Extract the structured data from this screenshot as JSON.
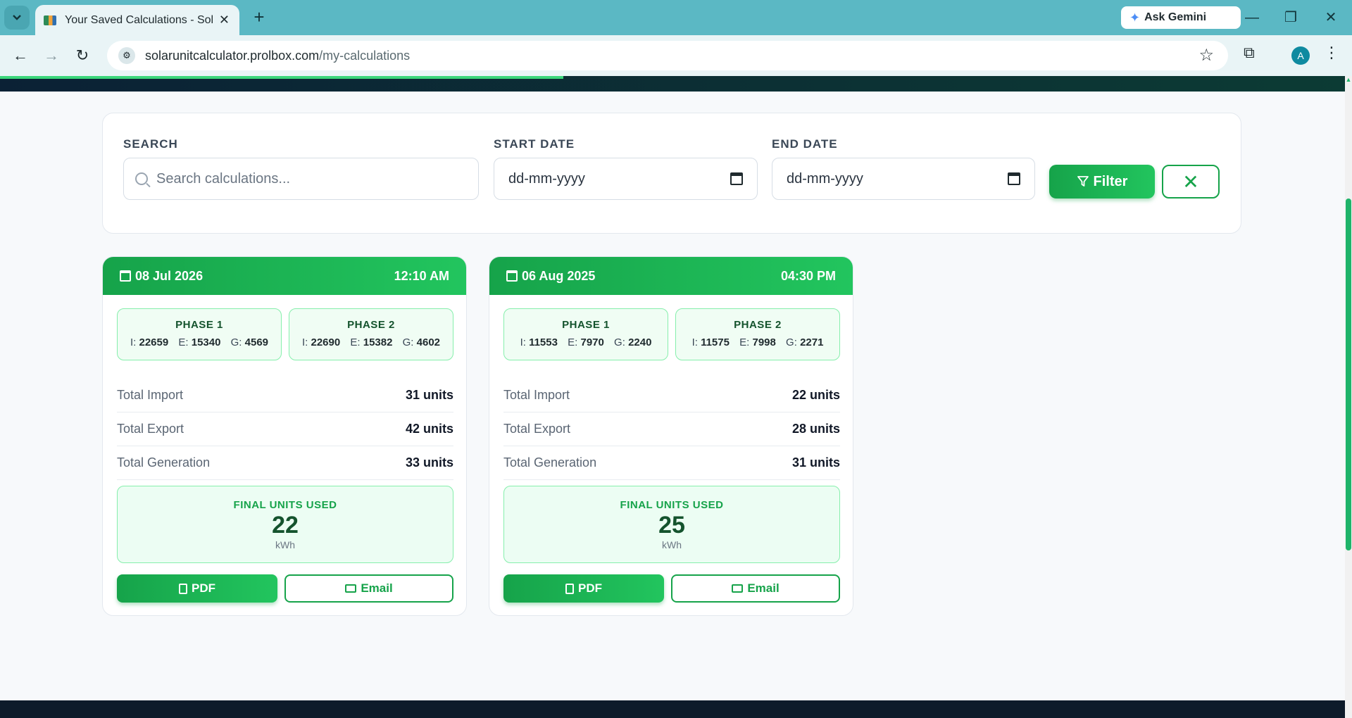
{
  "browser": {
    "tab_title": "Your Saved Calculations - Solar",
    "tab_close": "✕",
    "new_tab": "+",
    "gemini_label": "Ask Gemini",
    "url_host": "solarunitcalculator.prolbox.com",
    "url_path": "/my-calculations",
    "avatar_letter": "A"
  },
  "filters": {
    "search_label": "SEARCH",
    "search_placeholder": "Search calculations...",
    "start_label": "START DATE",
    "start_placeholder": "dd-mm-yyyy",
    "end_label": "END DATE",
    "end_placeholder": "dd-mm-yyyy",
    "filter_button": "Filter",
    "clear_button": "✕"
  },
  "cards": [
    {
      "date": "08 Jul 2026",
      "time": "12:10 AM",
      "phase1": {
        "title": "PHASE 1",
        "i_label": "I:",
        "i": "22659",
        "e_label": "E:",
        "e": "15340",
        "g_label": "G:",
        "g": "4569"
      },
      "phase2": {
        "title": "PHASE 2",
        "i_label": "I:",
        "i": "22690",
        "e_label": "E:",
        "e": "15382",
        "g_label": "G:",
        "g": "4602"
      },
      "rows": [
        {
          "label": "Total Import",
          "value": "31 units"
        },
        {
          "label": "Total Export",
          "value": "42 units"
        },
        {
          "label": "Total Generation",
          "value": "33 units"
        }
      ],
      "final_title": "FINAL UNITS USED",
      "final_value": "22",
      "final_unit": "kWh",
      "pdf_label": "PDF",
      "email_label": "Email"
    },
    {
      "date": "06 Aug 2025",
      "time": "04:30 PM",
      "phase1": {
        "title": "PHASE 1",
        "i_label": "I:",
        "i": "11553",
        "e_label": "E:",
        "e": "7970",
        "g_label": "G:",
        "g": "2240"
      },
      "phase2": {
        "title": "PHASE 2",
        "i_label": "I:",
        "i": "11575",
        "e_label": "E:",
        "e": "7998",
        "g_label": "G:",
        "g": "2271"
      },
      "rows": [
        {
          "label": "Total Import",
          "value": "22 units"
        },
        {
          "label": "Total Export",
          "value": "28 units"
        },
        {
          "label": "Total Generation",
          "value": "31 units"
        }
      ],
      "final_title": "FINAL UNITS USED",
      "final_value": "25",
      "final_unit": "kWh",
      "pdf_label": "PDF",
      "email_label": "Email"
    }
  ]
}
